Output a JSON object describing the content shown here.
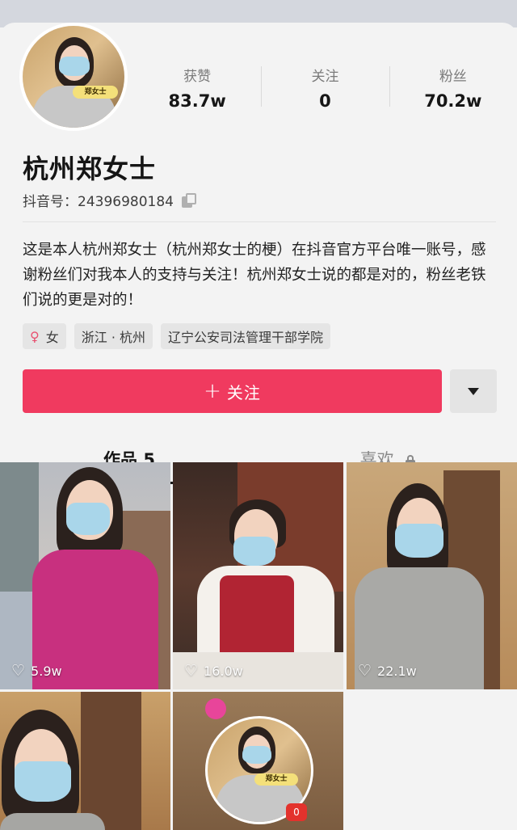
{
  "profile": {
    "avatar_badge": "郑女士",
    "name": "杭州郑女士",
    "douyin_id": "抖音号：24396980184",
    "bio": "这是本人杭州郑女士（杭州郑女士的梗）在抖音官方平台唯一账号，感谢粉丝们对我本人的支持与关注！杭州郑女士说的都是对的，粉丝老铁们说的更是对的！"
  },
  "stats": [
    {
      "label": "获赞",
      "value": "83.7w"
    },
    {
      "label": "关注",
      "value": "0"
    },
    {
      "label": "粉丝",
      "value": "70.2w"
    }
  ],
  "tags": {
    "gender": "女",
    "location": "浙江 · 杭州",
    "school": "辽宁公安司法管理干部学院"
  },
  "actions": {
    "follow_label": "关注",
    "follow_plus": "+"
  },
  "tabs": [
    {
      "label": "作品 5"
    },
    {
      "label": "喜欢"
    }
  ],
  "videos": [
    {
      "likes": "5.9w"
    },
    {
      "likes": "16.0w"
    },
    {
      "likes": "22.1w"
    },
    {
      "likes": ""
    },
    {
      "likes": "",
      "badge": "郑女士"
    }
  ],
  "colors": {
    "accent": "#f03a5f",
    "background": "#f3f3f3",
    "tag_bg": "#e5e5e5"
  },
  "icons": {
    "copy": "copy-icon",
    "gender": "female-icon",
    "dropdown": "triangle-down-icon",
    "lock": "lock-icon",
    "like": "heart-icon"
  }
}
